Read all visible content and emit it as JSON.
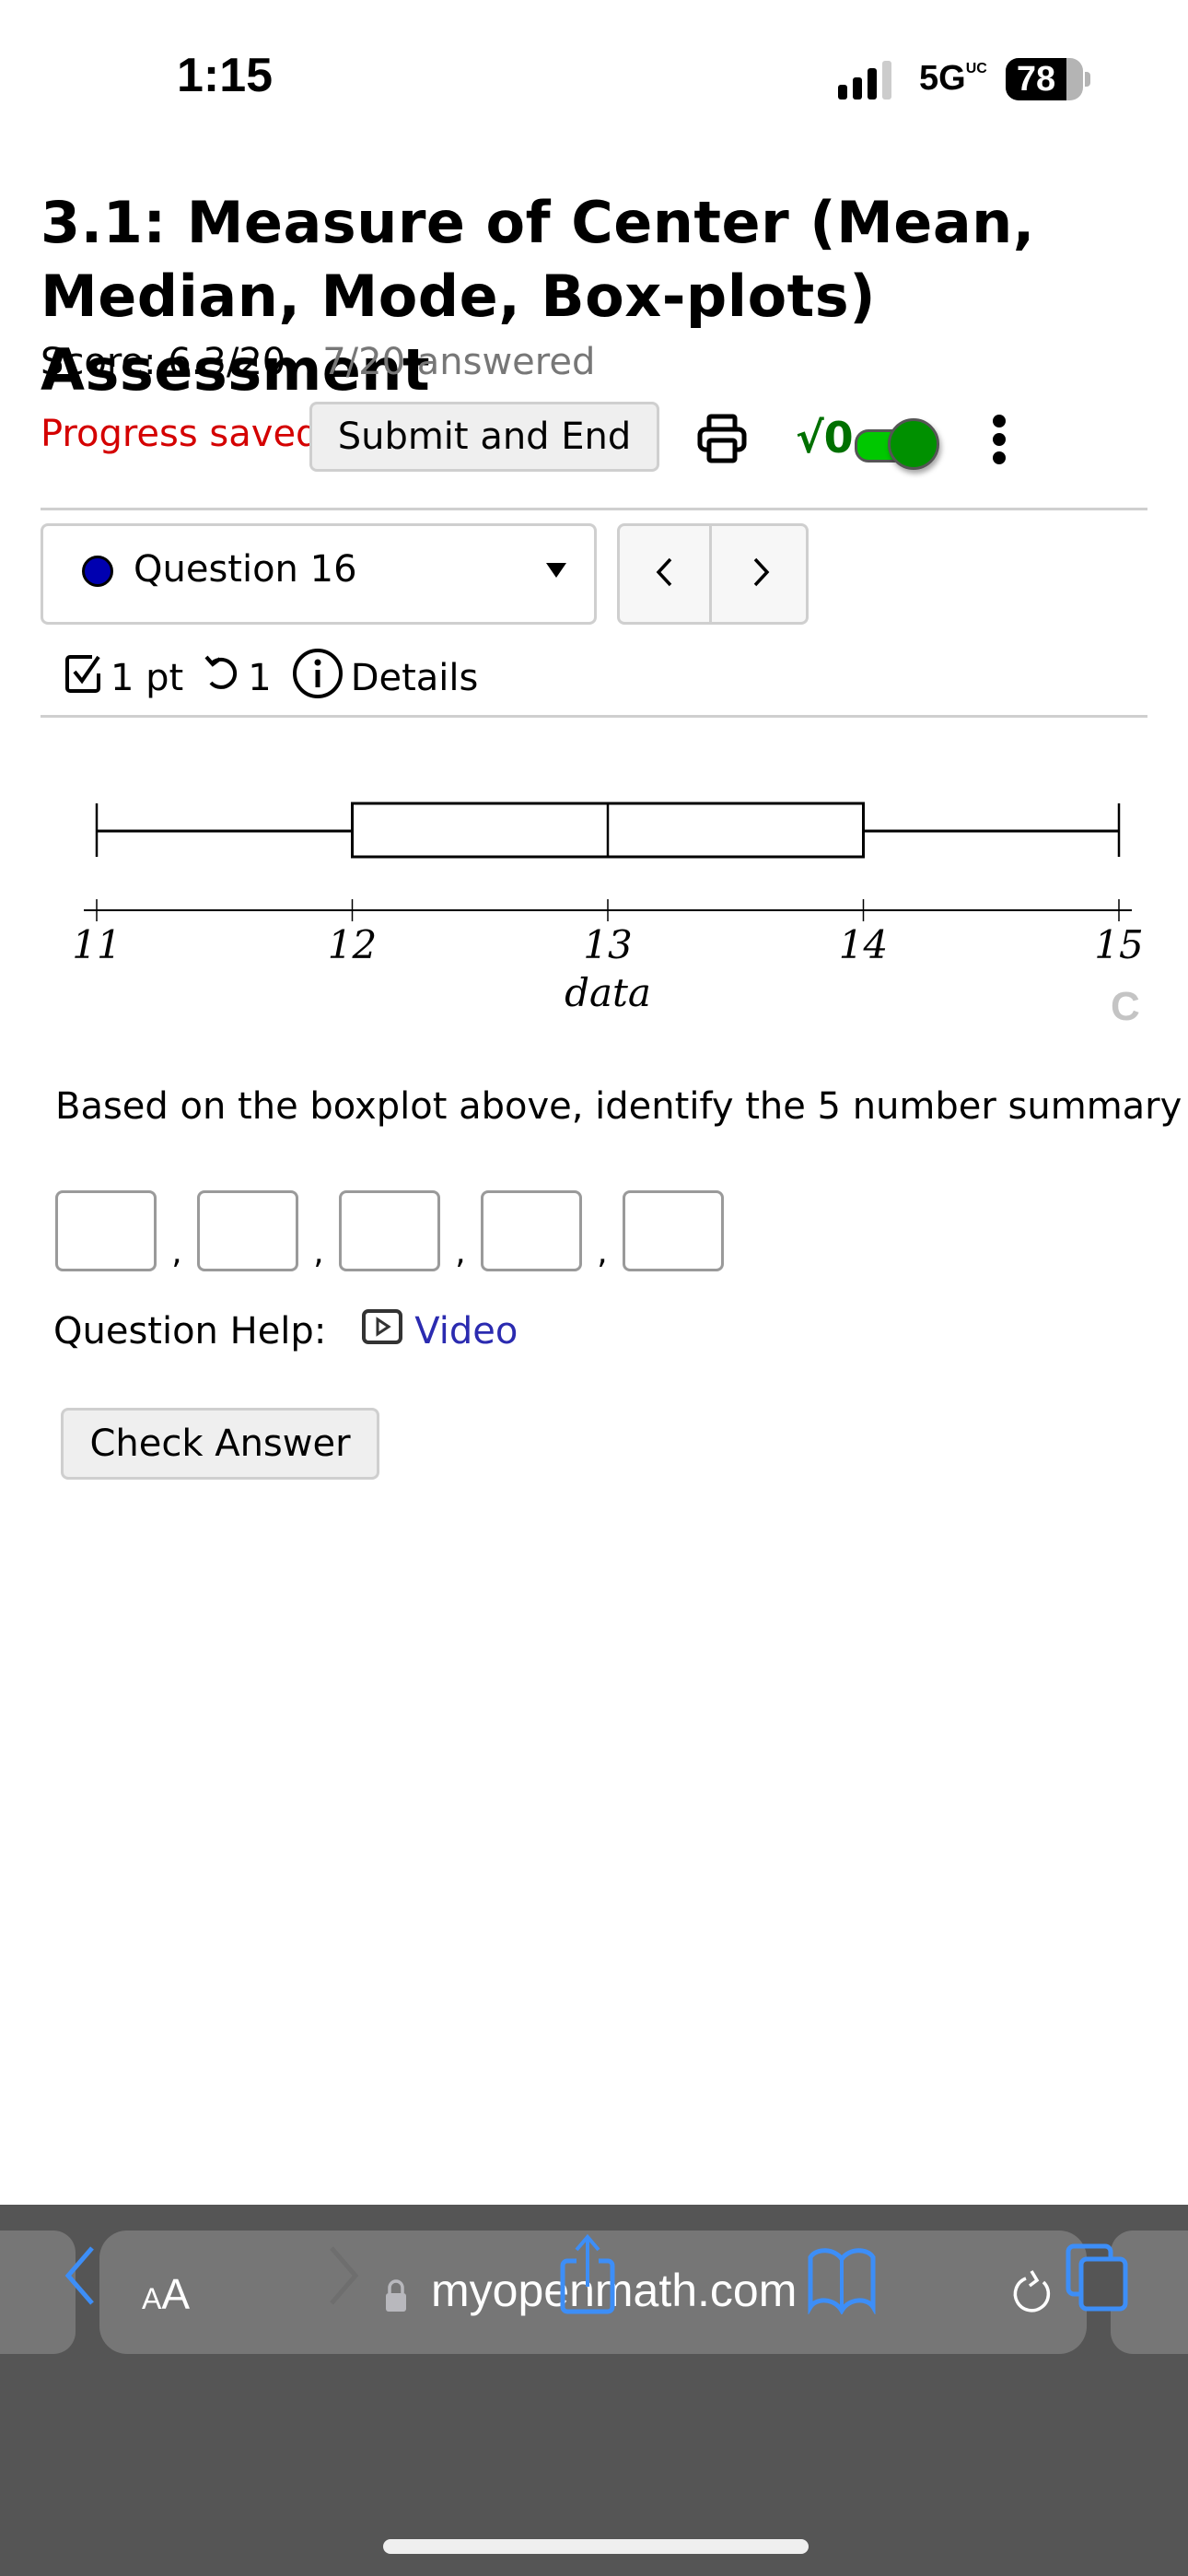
{
  "status_bar": {
    "time": "1:15",
    "network": "5G",
    "network_suffix": "UC",
    "battery_percent": 78
  },
  "header": {
    "title": "3.1: Measure of Center (Mean, Median, Mode, Box-plots) Assessment",
    "score": "Score: 6.3/20",
    "answered": "7/20 answered",
    "progress_status": "Progress saved",
    "submit_label": "Submit and End",
    "math_toggle_label": "√0",
    "math_toggle_on": true
  },
  "question_nav": {
    "selected": "Question 16",
    "prev_label": "<",
    "next_label": ">"
  },
  "question_meta": {
    "points": "1 pt",
    "attempts": "1",
    "details_label": "Details"
  },
  "chart_data": {
    "type": "boxplot",
    "xlabel": "data",
    "xlim": [
      11,
      15
    ],
    "ticks": [
      "11",
      "12",
      "13",
      "14",
      "15"
    ],
    "tick_values": [
      11,
      12,
      13,
      14,
      15
    ],
    "summary": {
      "min": 11,
      "q1": 12,
      "median": 13,
      "q3": 14,
      "max": 15
    },
    "grid": false
  },
  "refresh_glyph": "C",
  "question": {
    "prompt": "Based on the boxplot above, identify the 5 number summary",
    "answers": [
      "",
      "",
      "",
      "",
      ""
    ],
    "separator": ",",
    "help_label": "Question Help:",
    "video_label": "Video",
    "check_label": "Check Answer"
  },
  "browser": {
    "text_size_label": "AA",
    "url": "myopenmath.com"
  },
  "colors": {
    "progress_saved": "#d40000",
    "question_dot": "#0000b0",
    "toggle_on": "#00c800",
    "link": "#2b2bb0",
    "safari_accent": "#3d8ef7"
  }
}
